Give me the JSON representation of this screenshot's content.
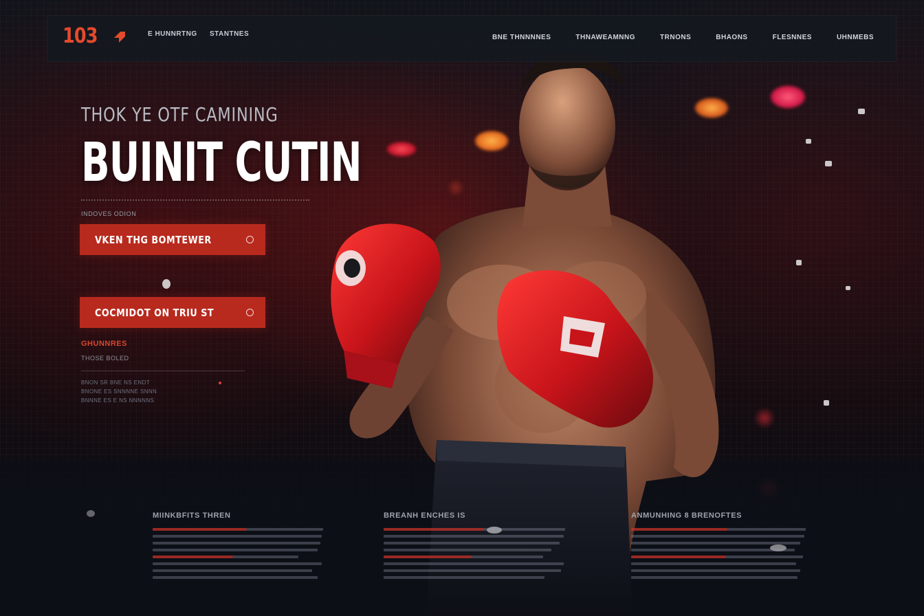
{
  "nav": {
    "logo": "103",
    "left_links": [
      "E HUNNRTNG",
      "STANTNES"
    ],
    "right_links": [
      "BNE THNNNNES",
      "THNAWEAMNNG",
      "TRNONS",
      "BHAONS",
      "FLESNNES",
      "UHNMEBS"
    ]
  },
  "hero": {
    "eyebrow": "THOK YE OTF CAMINING",
    "headline": "BUINIT CUTIN",
    "small_label": "INDOVES ODION",
    "cta_primary": "VKEN THG BOMTEWER",
    "cta_secondary": "COCMIDOT ON TRIU ST",
    "section_red": "GHUNNRES",
    "section_sub": "THOSE BOLED",
    "desc_lines": [
      "BNON SR BNE NS ENDT",
      "BNONE ES SNNNNE SNNN",
      "BNNNE ES E NS NNNNNS"
    ]
  },
  "footer": {
    "columns": [
      {
        "title": "MIINKBFITS THREN"
      },
      {
        "title": "BREANH ENCHES IS"
      },
      {
        "title": "ANMUNHING 8 BRENOFTES"
      }
    ]
  },
  "colors": {
    "accent": "#b82a1e",
    "logo": "#e44a2c",
    "background": "#0d0f14"
  },
  "icons": [
    "arrow-logo-icon",
    "circle-icon"
  ]
}
